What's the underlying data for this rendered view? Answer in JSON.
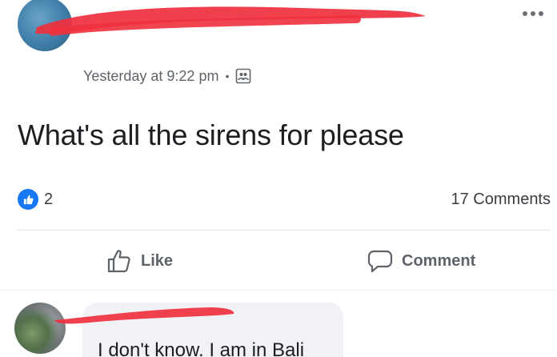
{
  "post": {
    "timestamp": "Yesterday at 9:22 pm",
    "separator": "•",
    "privacy_icon": "group-icon",
    "text": "What's all the sirens for please",
    "more_icon": "more-horizontal-icon"
  },
  "reactions": {
    "like_icon": "like-reaction-icon",
    "like_count": "2",
    "comments_count": "17 Comments"
  },
  "actions": {
    "like_label": "Like",
    "comment_label": "Comment"
  },
  "comment": {
    "text": "I don't know. I am in Bali"
  },
  "colors": {
    "accent": "#1877f2",
    "redaction": "#f0303e",
    "text_primary": "#1c1e21",
    "text_secondary": "#5e6369",
    "bubble": "#f0f2f5"
  }
}
